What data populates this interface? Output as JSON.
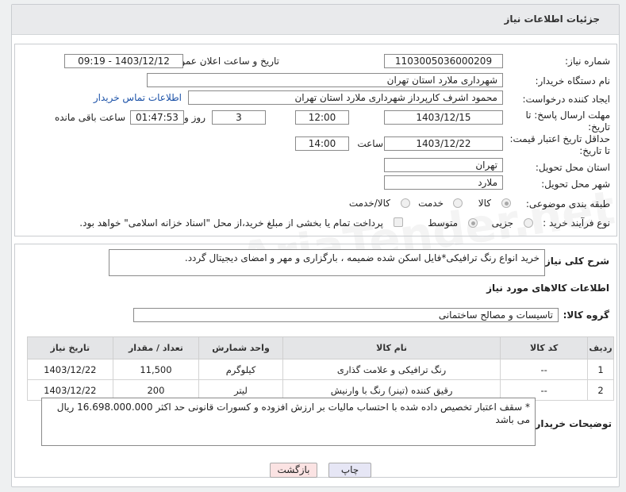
{
  "header": {
    "title": "جزئیات اطلاعات نیاز"
  },
  "form": {
    "need_number_label": "شماره نیاز:",
    "need_number": "1103005036000209",
    "announce_label": "تاریخ و ساعت اعلان عمومی:",
    "announce_value": "1403/12/12 - 09:19",
    "buyer_label": "نام دستگاه خریدار:",
    "buyer_value": "شهرداری ملارد استان تهران",
    "creator_label": "ایجاد کننده درخواست:",
    "creator_value": "محمود اشرف کارپرداز  شهرداری ملارد استان تهران",
    "contact_link": "اطلاعات تماس خریدار",
    "deadline_label": "مهلت ارسال پاسخ: تا تاریخ:",
    "deadline_date": "1403/12/15",
    "time_label": "ساعت",
    "deadline_time": "12:00",
    "days": "3",
    "days_label": "روز و",
    "remaining": "01:47:53",
    "remaining_label": "ساعت باقی مانده",
    "validity_label": "حداقل تاریخ اعتبار قیمت: تا تاریخ:",
    "validity_date": "1403/12/22",
    "validity_time_label": "ساعت",
    "validity_time": "14:00",
    "province_label": "استان محل تحویل:",
    "province_value": "تهران",
    "city_label": "شهر محل تحویل:",
    "city_value": "ملارد",
    "category_label": "طبقه بندی موضوعی:",
    "category_options": [
      "کالا",
      "خدمت",
      "کالا/خدمت"
    ],
    "process_label": "نوع فرآیند خرید :",
    "process_options": [
      "جزیی",
      "متوسط"
    ],
    "payment_note": "پرداخت تمام یا بخشی از مبلغ خرید،از محل \"اسناد خزانه اسلامی\" خواهد بود."
  },
  "summary": {
    "label": "شرح کلی نیاز:",
    "value": "خرید انواع رنگ ترافیکی*فایل اسکن شده ضمیمه ، بارگزاری و مهر و امضای دیجیتال گردد."
  },
  "goods_section_title": "اطلاعات کالاهای مورد نیاز",
  "goods_group": {
    "label": "گروه کالا:",
    "value": "تاسیسات و مصالح ساختمانی"
  },
  "table": {
    "headers": [
      "ردیف",
      "کد کالا",
      "نام کالا",
      "واحد شمارش",
      "تعداد / مقدار",
      "تاریخ نیاز"
    ],
    "rows": [
      [
        "1",
        "--",
        "رنگ ترافیکی و علامت گذاری",
        "کیلوگرم",
        "11,500",
        "1403/12/22"
      ],
      [
        "2",
        "--",
        "رقیق کننده (تینر) رنگ با وارنیش",
        "لیتر",
        "200",
        "1403/12/22"
      ]
    ]
  },
  "notes": {
    "label": "توضیحات خریدار:",
    "value": "* سقف اعتبار تخصیص داده شده با احتساب مالیات بر ارزش افزوده و کسورات قانونی حد اکثر    16.698.000.000  ریال می باشد"
  },
  "buttons": {
    "print": "چاپ",
    "back": "بازگشت"
  },
  "watermark": "AriaTender.net"
}
